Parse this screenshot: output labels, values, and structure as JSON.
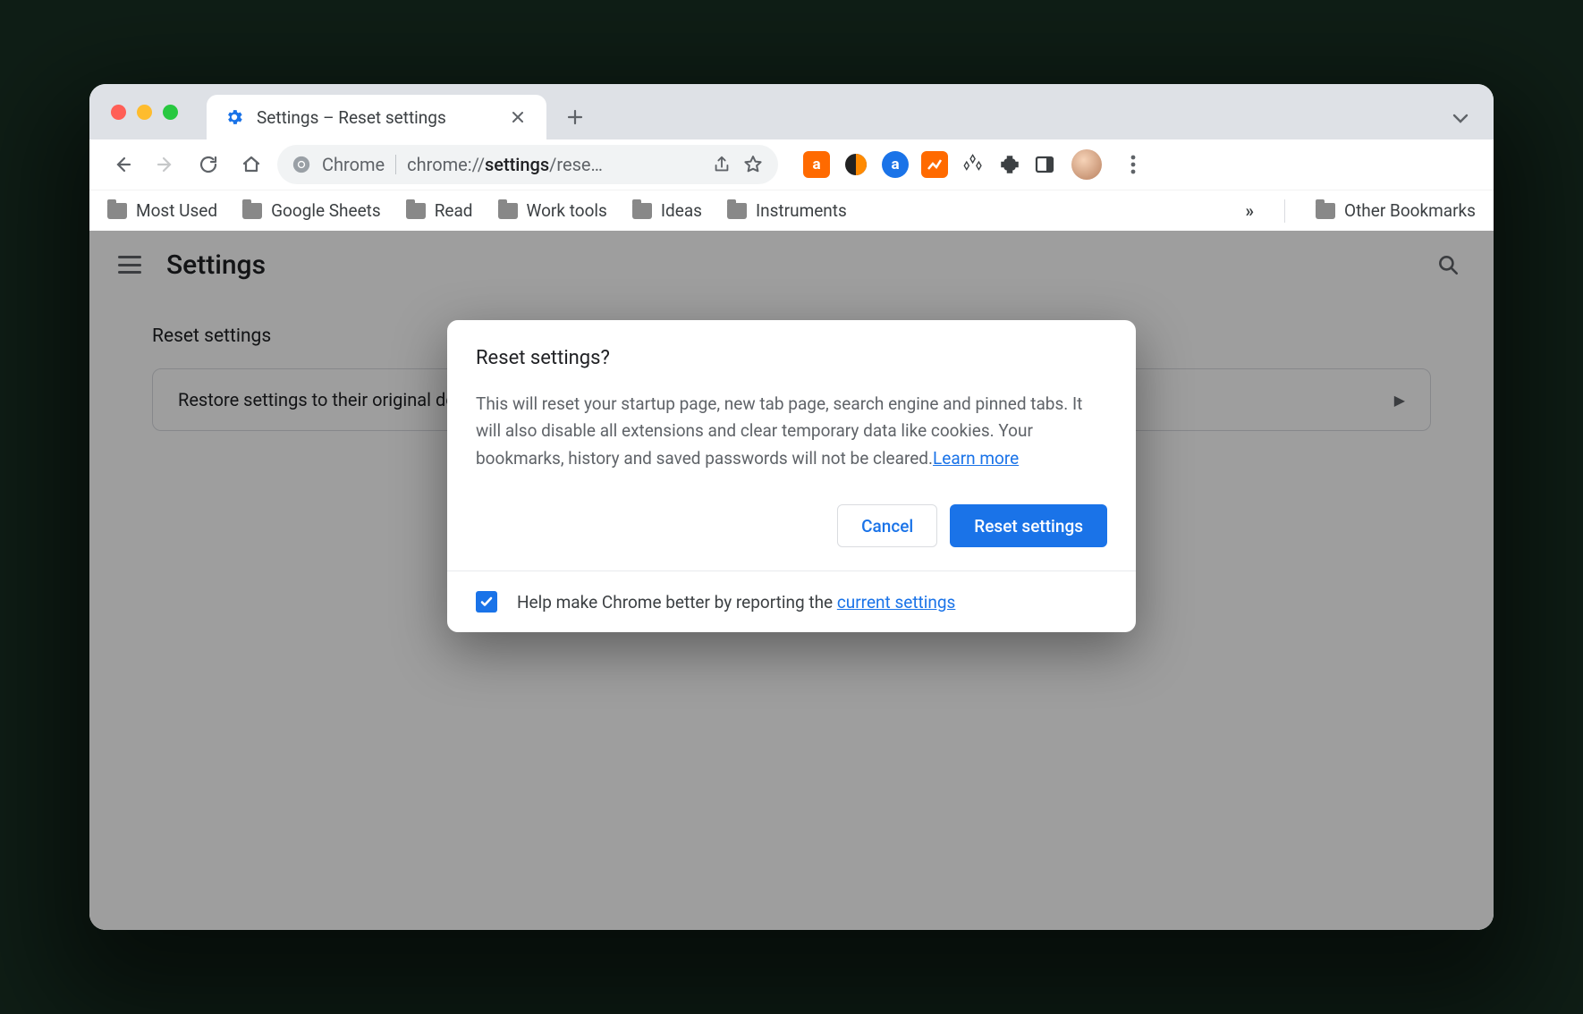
{
  "tab": {
    "title": "Settings – Reset settings"
  },
  "omnibox": {
    "prefix_label": "Chrome",
    "url_gray1": "chrome://",
    "url_bold": "settings",
    "url_gray2": "/rese…"
  },
  "bookmarks": {
    "items": [
      "Most Used",
      "Google Sheets",
      "Read",
      "Work tools",
      "Ideas",
      "Instruments"
    ],
    "overflow": "»",
    "other": "Other Bookmarks"
  },
  "settings": {
    "header": "Settings",
    "section_title": "Reset settings",
    "card_label": "Restore settings to their original defaults"
  },
  "dialog": {
    "title": "Reset settings?",
    "body": "This will reset your startup page, new tab page, search engine and pinned tabs. It will also disable all extensions and clear temporary data like cookies. Your bookmarks, history and saved passwords will not be cleared.",
    "learn_more": "Learn more",
    "cancel": "Cancel",
    "confirm": "Reset settings",
    "footer_text": "Help make Chrome better by reporting the ",
    "footer_link": "current settings"
  }
}
